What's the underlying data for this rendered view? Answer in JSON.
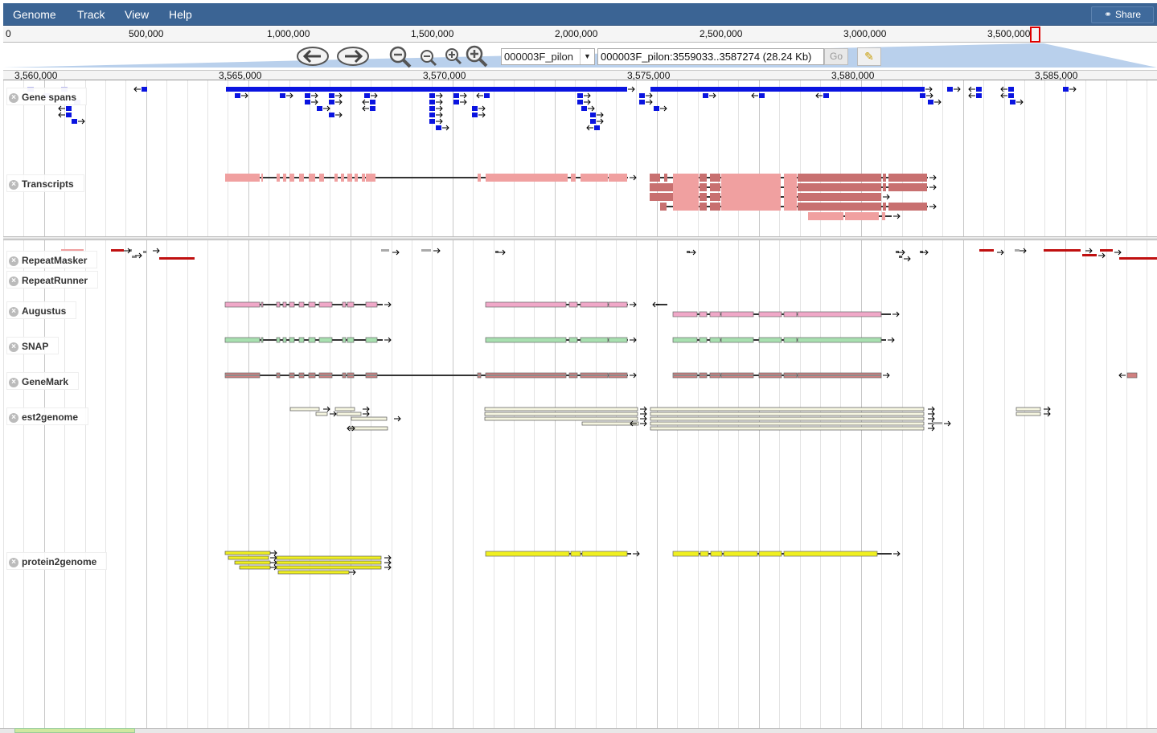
{
  "menu": {
    "items": [
      {
        "label": "Genome",
        "name": "menu-genome"
      },
      {
        "label": "Track",
        "name": "menu-track"
      },
      {
        "label": "View",
        "name": "menu-view"
      },
      {
        "label": "Help",
        "name": "menu-help"
      }
    ],
    "share_label": "Share"
  },
  "overview": {
    "labels": [
      "0",
      "500,000",
      "1,000,000",
      "1,500,000",
      "2,000,000",
      "2,500,000",
      "3,000,000",
      "3,500,000"
    ]
  },
  "navigation": {
    "refseq": "000003F_pilon",
    "location": "000003F_pilon:3559033..3587274 (28.24 Kb)",
    "go_label": "Go",
    "highlight_icon": "highlighter-icon"
  },
  "ruler": {
    "labels": [
      "3,560,000",
      "3,565,000",
      "3,570,000",
      "3,575,000",
      "3,580,000",
      "3,585,000"
    ]
  },
  "tracks": [
    {
      "label": "Gene spans",
      "name": "track-gene-spans"
    },
    {
      "label": "Transcripts",
      "name": "track-transcripts"
    },
    {
      "label": "RepeatMasker",
      "name": "track-repeatmasker"
    },
    {
      "label": "RepeatRunner",
      "name": "track-repeatrunner"
    },
    {
      "label": "Augustus",
      "name": "track-augustus"
    },
    {
      "label": "SNAP",
      "name": "track-snap"
    },
    {
      "label": "GeneMark",
      "name": "track-genemark"
    },
    {
      "label": "est2genome",
      "name": "track-est2genome"
    },
    {
      "label": "protein2genome",
      "name": "track-protein2genome"
    }
  ],
  "colors": {
    "menubar": "#3b6494",
    "gene_span": "#0a14e0",
    "transcript": "#f0a0a0",
    "transcript_dark": "#c87070",
    "repeat": "#c01010",
    "augustus": "#f0a8c8",
    "snap": "#a8e0b0",
    "genemark": "#d08080",
    "est": "#f5f5e0",
    "protein": "#f0f020"
  }
}
